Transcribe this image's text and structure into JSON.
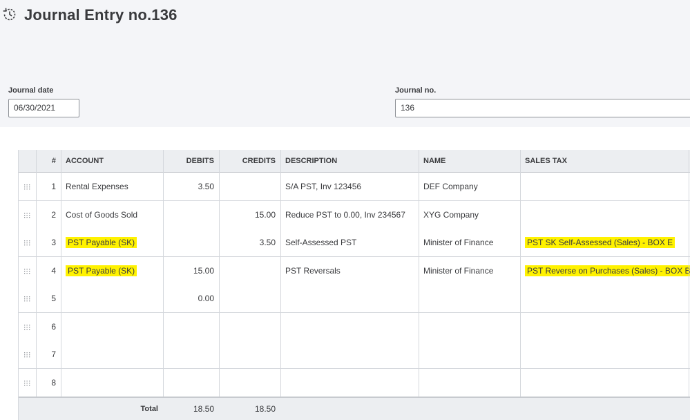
{
  "header": {
    "title": "Journal Entry no.136",
    "history_icon": "history-icon"
  },
  "form": {
    "journal_date_label": "Journal date",
    "journal_date_value": "06/30/2021",
    "journal_no_label": "Journal no.",
    "journal_no_value": "136"
  },
  "table": {
    "columns": [
      "#",
      "ACCOUNT",
      "DEBITS",
      "CREDITS",
      "DESCRIPTION",
      "NAME",
      "SALES TAX"
    ],
    "rows": [
      {
        "num": "1",
        "account": "Rental Expenses",
        "debit": "3.50",
        "credit": "",
        "description": "S/A PST, Inv 123456",
        "name": "DEF Company",
        "sales_tax": ""
      },
      {
        "num": "2",
        "account": "Cost of Goods Sold",
        "debit": "",
        "credit": "15.00",
        "description": "Reduce PST to 0.00, Inv 234567",
        "name": "XYG Company",
        "sales_tax": ""
      },
      {
        "num": "3",
        "account": "PST Payable (SK)",
        "debit": "",
        "credit": "3.50",
        "description": "Self-Assessed PST",
        "name": "Minister of Finance",
        "sales_tax": "PST SK Self-Assessed (Sales) - BOX E"
      },
      {
        "num": "4",
        "account": "PST Payable (SK)",
        "debit": "15.00",
        "credit": "",
        "description": "PST Reversals",
        "name": "Minister of Finance",
        "sales_tax": "PST Reverse on Purchases (Sales) - BOX B"
      },
      {
        "num": "5",
        "account": "",
        "debit": "0.00",
        "credit": "",
        "description": "",
        "name": "",
        "sales_tax": ""
      },
      {
        "num": "6",
        "account": "",
        "debit": "",
        "credit": "",
        "description": "",
        "name": "",
        "sales_tax": ""
      },
      {
        "num": "7",
        "account": "",
        "debit": "",
        "credit": "",
        "description": "",
        "name": "",
        "sales_tax": ""
      },
      {
        "num": "8",
        "account": "",
        "debit": "",
        "credit": "",
        "description": "",
        "name": "",
        "sales_tax": ""
      }
    ],
    "highlighted_rows": [
      2,
      3
    ],
    "highlight_color": "#fff200",
    "footer": {
      "label": "Total",
      "debits_total": "18.50",
      "credits_total": "18.50"
    }
  }
}
